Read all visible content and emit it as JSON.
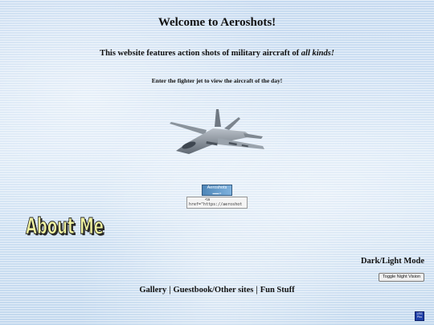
{
  "header": {
    "title": "Welcome to Aeroshots!",
    "subtitle_main": "This website features action shots of military aircraft of ",
    "subtitle_emphasis": "all kinds!",
    "instruction": "Enter the fighter jet to view the aircraft of the day!"
  },
  "jet": {
    "icon": "fighter-jet-icon"
  },
  "banner": {
    "label": "Aeroshots",
    "sub": "▬▬ ▸"
  },
  "code_box": {
    "line1": "<a",
    "line2": "href=\"https://aeroshot"
  },
  "about": {
    "label": "About Me"
  },
  "mode": {
    "heading": "Dark/Light Mode",
    "toggle_label": "Toggle Night Vision"
  },
  "nav": {
    "gallery": "Gallery",
    "separator": "|",
    "guestbook": "Guestbook/Other sites",
    "fun": "Fun Stuff"
  },
  "corner_badge": {
    "line1": "LRS",
    "line2": "Pho"
  },
  "colors": {
    "sky": "#cfe0f2",
    "banner": "#4e86b8",
    "badge": "#1f3fa8"
  }
}
